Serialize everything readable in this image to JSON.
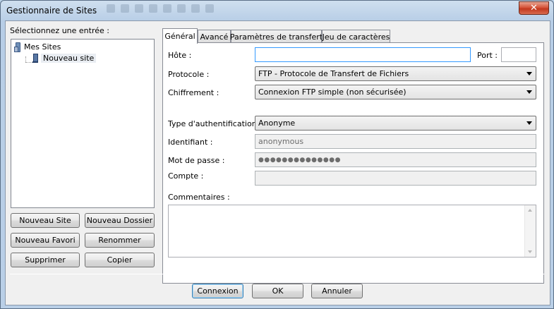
{
  "window": {
    "title": "Gestionnaire de Sites",
    "close_symbol": "✕"
  },
  "left": {
    "select_label": "Sélectionnez une entrée :",
    "tree": {
      "root": "Mes Sites",
      "site": "Nouveau site"
    },
    "buttons": {
      "new_site": "Nouveau Site",
      "new_folder": "Nouveau Dossier",
      "new_bookmark": "Nouveau Favori",
      "rename": "Renommer",
      "delete": "Supprimer",
      "copy": "Copier"
    }
  },
  "tabs": [
    "Général",
    "Avancé",
    "Paramètres de transfert",
    "Jeu de caractères"
  ],
  "general": {
    "host_label": "Hôte :",
    "host_value": "",
    "port_label": "Port :",
    "port_value": "",
    "protocol_label": "Protocole :",
    "protocol_value": "FTP - Protocole de Transfert de Fichiers",
    "encryption_label": "Chiffrement :",
    "encryption_value": "Connexion FTP simple (non sécurisée)",
    "auth_label": "Type d'authentification :",
    "auth_value": "Anonyme",
    "user_label": "Identifiant :",
    "user_value": "anonymous",
    "password_label": "Mot de passe :",
    "password_value": "●●●●●●●●●●●●●●",
    "account_label": "Compte :",
    "account_value": "",
    "comments_label": "Commentaires :",
    "comments_value": ""
  },
  "footer": {
    "connect": "Connexion",
    "ok": "OK",
    "cancel": "Annuler"
  }
}
